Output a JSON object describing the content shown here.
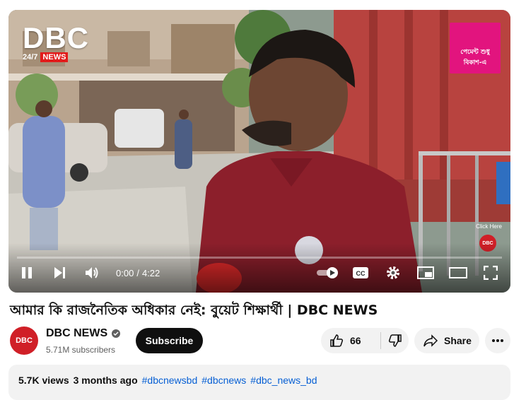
{
  "player": {
    "channel_logo": {
      "big": "DBC",
      "sub_left": "24/7",
      "sub_right": "NEWS"
    },
    "promo": {
      "line1": "পেমেন্ট শুধু",
      "line2": "বিকাশ-এ"
    },
    "overlay": {
      "click_here": "Click Here",
      "badge": "DBC"
    },
    "time": {
      "current": "0:00",
      "separator": "/",
      "duration": "4:22"
    },
    "progress_fraction": 0.0,
    "accent_color": "#ff0000",
    "icons": [
      "pause-icon",
      "next-icon",
      "volume-icon",
      "autoplay-toggle-icon",
      "captions-icon",
      "settings-icon",
      "miniplayer-icon",
      "theater-icon",
      "fullscreen-icon"
    ]
  },
  "video": {
    "title": "আমার কি রাজনৈতিক অধিকার নেই: বুয়েট শিক্ষার্থী | DBC NEWS"
  },
  "channel": {
    "avatar_text": "DBC",
    "name": "DBC NEWS",
    "subscribers": "5.71M subscribers",
    "subscribe_label": "Subscribe",
    "brand_color": "#d01f27"
  },
  "actions": {
    "like_count": "66",
    "share_label": "Share"
  },
  "description": {
    "views": "5.7K views",
    "ago": "3 months ago",
    "tags": [
      "#dbcnewsbd",
      "#dbcnews",
      "#dbc_news_bd"
    ]
  }
}
